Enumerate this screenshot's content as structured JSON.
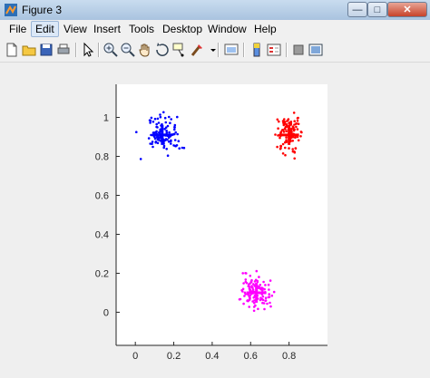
{
  "window": {
    "title": "Figure 3",
    "buttons": {
      "minimize": "—",
      "maximize": "□",
      "close": "✕"
    }
  },
  "menu": [
    "File",
    "Edit",
    "View",
    "Insert",
    "Tools",
    "Desktop",
    "Window",
    "Help"
  ],
  "menu_active_index": 1,
  "toolbar_icons": [
    "new-figure-icon",
    "open-file-icon",
    "save-icon",
    "print-icon",
    "select-arrow-icon",
    "zoom-in-icon",
    "zoom-out-icon",
    "pan-hand-icon",
    "rotate-3d-icon",
    "data-cursor-icon",
    "brush-icon",
    "brush-dropdown-icon",
    "link-plot-icon",
    "insert-colorbar-icon",
    "insert-legend-icon",
    "hide-plot-tools-icon",
    "show-plot-tools-icon"
  ],
  "colors": {
    "blue": "#0000ff",
    "red": "#ff0000",
    "magenta": "#ff00ff"
  },
  "chart_data": {
    "type": "scatter",
    "title": "",
    "xlabel": "",
    "ylabel": "",
    "xlim": [
      -0.1,
      1.0
    ],
    "ylim": [
      -0.17,
      1.17
    ],
    "xticks": [
      "0",
      "0.2",
      "0.4",
      "0.6",
      "0.8"
    ],
    "xtick_values": [
      0,
      0.2,
      0.4,
      0.6,
      0.8
    ],
    "yticks": [
      "0",
      "0.2",
      "0.4",
      "0.6",
      "0.8",
      "1"
    ],
    "ytick_values": [
      0,
      0.2,
      0.4,
      0.6,
      0.8,
      1.0
    ],
    "series": [
      {
        "color": "#0000ff",
        "center": [
          0.14,
          0.91
        ],
        "spread": [
          0.1,
          0.1
        ],
        "count": 110,
        "seed": 11
      },
      {
        "color": "#ff0000",
        "center": [
          0.8,
          0.91
        ],
        "spread": [
          0.06,
          0.1
        ],
        "count": 110,
        "seed": 23
      },
      {
        "color": "#ff00ff",
        "center": [
          0.63,
          0.1
        ],
        "spread": [
          0.09,
          0.09
        ],
        "count": 110,
        "seed": 37
      }
    ],
    "centroids": [
      {
        "x": 0.14,
        "y": 0.91,
        "color": "#0000ff"
      },
      {
        "x": 0.8,
        "y": 0.91,
        "color": "#ff0000"
      },
      {
        "x": 0.63,
        "y": 0.1,
        "color": "#ff00ff"
      }
    ]
  }
}
